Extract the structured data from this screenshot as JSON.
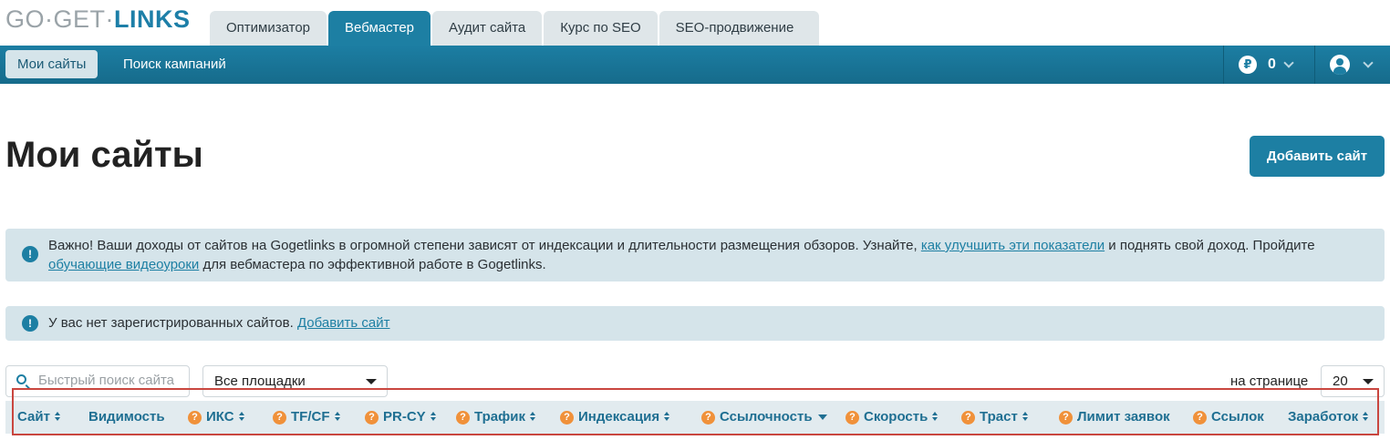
{
  "logo": {
    "part1": "GO·GET·",
    "part2": "LINKS"
  },
  "tabs": [
    {
      "label": "Оптимизатор",
      "active": false
    },
    {
      "label": "Вебмастер",
      "active": true
    },
    {
      "label": "Аудит сайта",
      "active": false
    },
    {
      "label": "Курс по SEO",
      "active": false
    },
    {
      "label": "SEO-продвижение",
      "active": false
    }
  ],
  "nav": {
    "items": [
      {
        "label": "Мои сайты",
        "active": true
      },
      {
        "label": "Поиск кампаний",
        "active": false
      }
    ],
    "currency_symbol": "₽",
    "balance": "0"
  },
  "page": {
    "title": "Мои сайты",
    "add_button": "Добавить сайт"
  },
  "alerts": {
    "info_icon": "!",
    "alert1": {
      "text1": "Важно! Ваши доходы от сайтов на Gogetlinks в огромной степени зависят от индексации и длительности размещения обзоров. Узнайте, ",
      "link1": "как улучшить эти показатели",
      "text2": " и поднять свой доход. Пройдите ",
      "link2": "обучающие видеоуроки",
      "text3": " для вебмастера по эффективной работе в Gogetlinks."
    },
    "alert2": {
      "text": "У вас нет зарегистрированных сайтов. ",
      "link": "Добавить сайт"
    }
  },
  "filters": {
    "search_placeholder": "Быстрый поиск сайта",
    "platform_select": "Все площадки",
    "per_page_label": "на странице",
    "per_page_value": "20"
  },
  "table": {
    "help_icon": "?",
    "columns": [
      {
        "label": "Сайт",
        "help": false,
        "sort": "both"
      },
      {
        "label": "Видимость",
        "help": false,
        "sort": "none"
      },
      {
        "label": "ИКС",
        "help": true,
        "sort": "both"
      },
      {
        "label": "TF/CF",
        "help": true,
        "sort": "both"
      },
      {
        "label": "PR-CY",
        "help": true,
        "sort": "both"
      },
      {
        "label": "Трафик",
        "help": true,
        "sort": "both"
      },
      {
        "label": "Индексация",
        "help": true,
        "sort": "both"
      },
      {
        "label": "Ссылочность",
        "help": true,
        "sort": "desc"
      },
      {
        "label": "Скорость",
        "help": true,
        "sort": "both"
      },
      {
        "label": "Траст",
        "help": true,
        "sort": "both"
      },
      {
        "label": "Лимит заявок",
        "help": true,
        "sort": "none"
      },
      {
        "label": "Ссылок",
        "help": true,
        "sort": "none"
      },
      {
        "label": "Заработок",
        "help": false,
        "sort": "both"
      }
    ]
  }
}
